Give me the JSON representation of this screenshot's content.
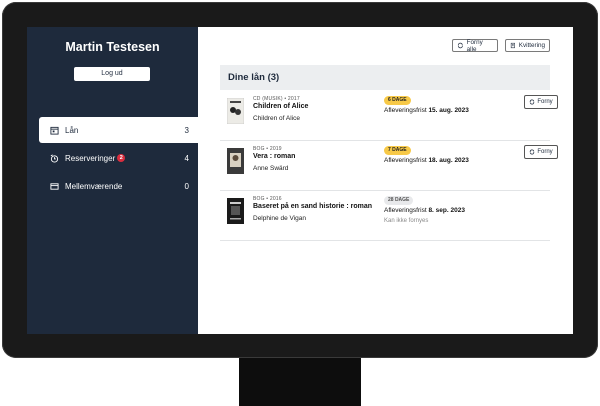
{
  "sidebar": {
    "user_name": "Martin Testesen",
    "logout_label": "Log ud",
    "nav": [
      {
        "label": "Lån",
        "count": "3",
        "icon": "calendar-icon",
        "active": true
      },
      {
        "label": "Reserveringer",
        "count": "4",
        "icon": "reservation-icon",
        "badge": "2"
      },
      {
        "label": "Mellemværende",
        "count": "0",
        "icon": "card-icon"
      }
    ]
  },
  "toolbar": {
    "renew_all_label": "Forny alle",
    "receipt_label": "Kvittering"
  },
  "loans": {
    "heading": "Dine lån (3)",
    "items": [
      {
        "meta": "CD (MUSIK) • 2017",
        "title": "Children of Alice",
        "author": "Children of Alice",
        "days": "6 DAGE",
        "days_color": "#f7c948",
        "due_label": "Afleveringsfrist",
        "due_date": "15. aug. 2023",
        "renew_label": "Forny"
      },
      {
        "meta": "BOG • 2019",
        "title": "Vera : roman",
        "author": "Anne Swärd",
        "days": "7 DAGE",
        "days_color": "#f7c948",
        "due_label": "Afleveringsfrist",
        "due_date": "18. aug. 2023",
        "renew_label": "Forny"
      },
      {
        "meta": "BOG • 2016",
        "title": "Baseret på en sand historie : roman",
        "author": "Delphine de Vigan",
        "days": "28 DAGE",
        "days_color": "#e8e9eb",
        "due_label": "Afleveringsfrist",
        "due_date": "8. sep. 2023",
        "note": "Kan ikke fornyes"
      }
    ]
  },
  "colors": {
    "sidebar_bg": "#1e2a3c",
    "badge_warn": "#f7c948",
    "badge_red": "#d92d3e"
  }
}
